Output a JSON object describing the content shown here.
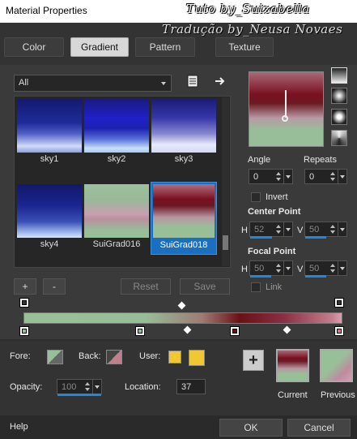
{
  "window": {
    "title": "Material Properties"
  },
  "watermark": {
    "line1": "Tuto by_Suizabella",
    "line2": "Tradução by_Neusa Novaes"
  },
  "tabs": [
    {
      "label": "Color"
    },
    {
      "label": "Gradient"
    },
    {
      "label": "Pattern"
    },
    {
      "label": "Texture"
    }
  ],
  "category": {
    "value": "All"
  },
  "gallery": {
    "items": [
      {
        "label": "sky1"
      },
      {
        "label": "sky2"
      },
      {
        "label": "sky3"
      },
      {
        "label": "sky4"
      },
      {
        "label": "SuiGrad016"
      },
      {
        "label": "SuiGrad018"
      }
    ],
    "selected": "SuiGrad018"
  },
  "gallery_buttons": {
    "add": "+",
    "remove": "-",
    "reset": "Reset",
    "save": "Save"
  },
  "angle": {
    "label": "Angle",
    "value": "0"
  },
  "repeats": {
    "label": "Repeats",
    "value": "0"
  },
  "invert": {
    "label": "Invert"
  },
  "center_point": {
    "label": "Center Point",
    "h_label": "H",
    "h_value": "52",
    "v_label": "V",
    "v_value": "50"
  },
  "focal_point": {
    "label": "Focal Point",
    "h_label": "H",
    "h_value": "50",
    "v_label": "V",
    "v_value": "50"
  },
  "link": {
    "label": "Link"
  },
  "fore": {
    "label": "Fore:"
  },
  "back": {
    "label": "Back:"
  },
  "user": {
    "label": "User:"
  },
  "opacity": {
    "label": "Opacity:",
    "value": "100"
  },
  "location": {
    "label": "Location:",
    "value": "37"
  },
  "current": {
    "label": "Current"
  },
  "previous": {
    "label": "Previous"
  },
  "footer": {
    "help": "Help",
    "ok": "OK",
    "cancel": "Cancel"
  },
  "colors": {
    "accent": "#1e88e5",
    "user_swatch": "#f0c832"
  }
}
